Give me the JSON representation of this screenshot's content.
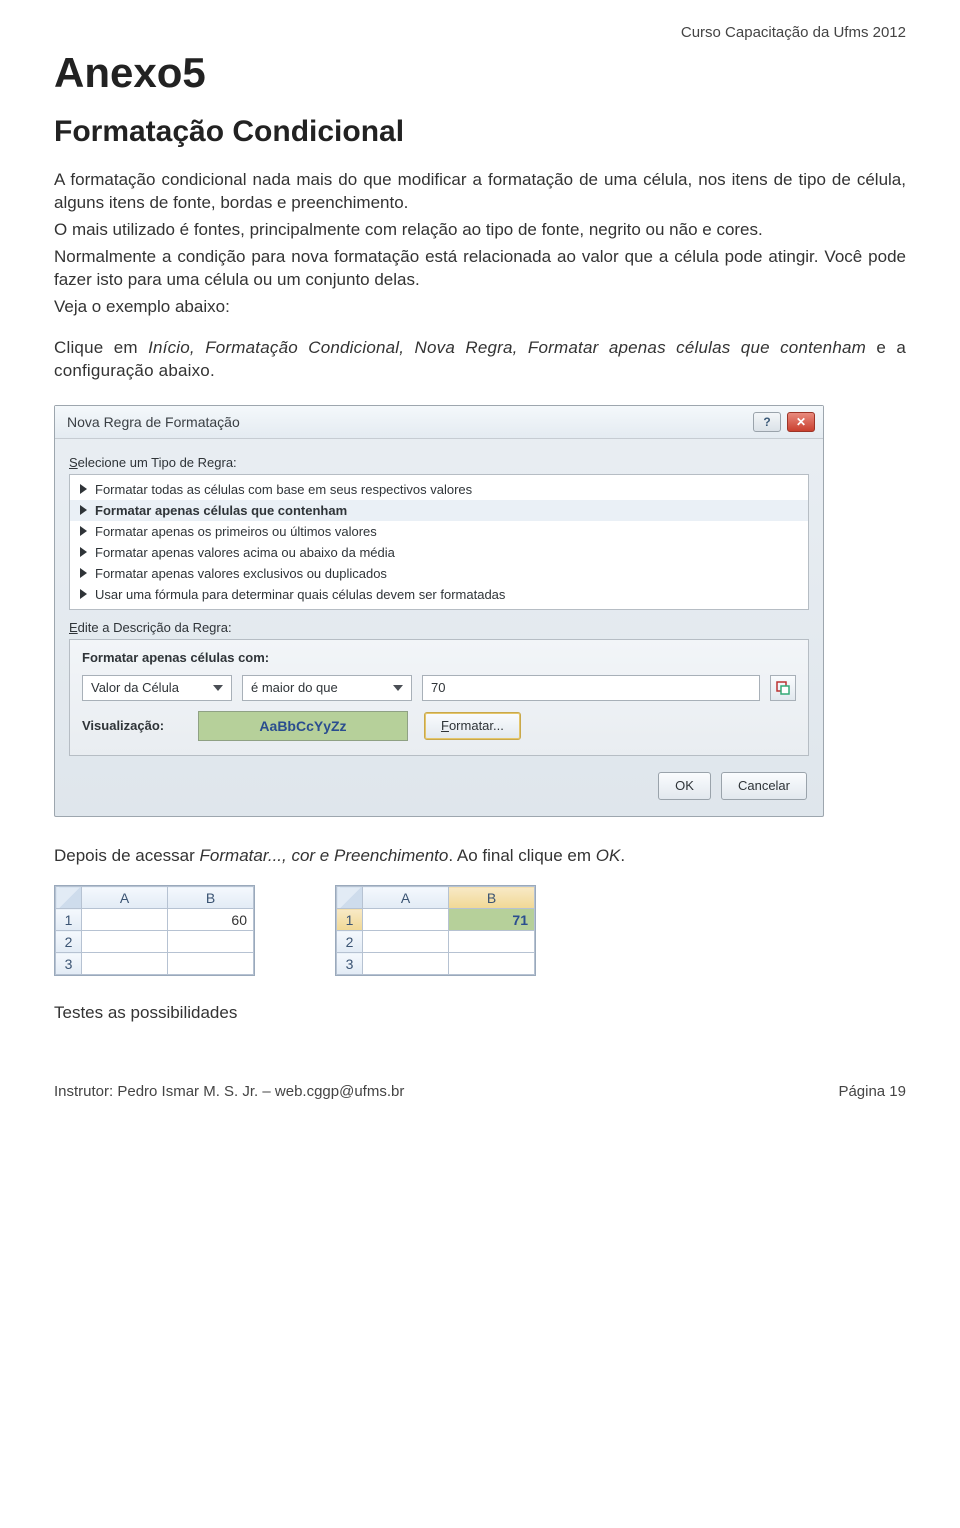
{
  "header": {
    "course": "Curso Capacitação da Ufms 2012"
  },
  "titles": {
    "h1": "Anexo5",
    "h2": "Formatação Condicional"
  },
  "paragraphs": {
    "p1": "A formatação condicional nada mais do que modificar a formatação de uma célula, nos itens de tipo de célula, alguns itens de fonte, bordas e preenchimento.",
    "p2": "O mais utilizado é fontes, principalmente com relação ao tipo de fonte, negrito ou não e cores.",
    "p3": "Normalmente a condição para nova formatação está relacionada ao valor que a célula pode atingir. Você pode fazer isto para uma célula ou um conjunto delas.",
    "p4": "Veja o exemplo abaixo:",
    "p5_prefix": "Clique em ",
    "p5_italic": "Início, Formatação Condicional, Nova Regra, Formatar apenas células que contenham",
    "p5_suffix": " e a configuração abaixo."
  },
  "dialog": {
    "title": "Nova Regra de Formatação",
    "help": "?",
    "close": "✕",
    "select_label_u": "S",
    "select_label_rest": "elecione um Tipo de Regra:",
    "rules": [
      "Formatar todas as células com base em seus respectivos valores",
      "Formatar apenas células que contenham",
      "Formatar apenas os primeiros ou últimos valores",
      "Formatar apenas valores acima ou abaixo da média",
      "Formatar apenas valores exclusivos ou duplicados",
      "Usar uma fórmula para determinar quais células devem ser formatadas"
    ],
    "edit_label_u": "E",
    "edit_label_rest": "dite a Descrição da Regra:",
    "sub_title": "Formatar apenas células com:",
    "combo1": "Valor da Célula",
    "combo2": "é maior do que",
    "value": "70",
    "preview_label": "Visualização:",
    "preview_text": "AaBbCcYyZz",
    "format_btn_u": "F",
    "format_btn_rest": "ormatar...",
    "ok": "OK",
    "cancel": "Cancelar"
  },
  "after": {
    "prefix": "Depois de acessar ",
    "italic1": "Formatar..., cor e Preenchimento",
    "mid": ". Ao final clique em ",
    "italic2": "OK",
    "suffix": "."
  },
  "sheets": {
    "left": {
      "cols": [
        "A",
        "B"
      ],
      "rows": [
        "1",
        "2",
        "3"
      ],
      "b1": "60"
    },
    "right": {
      "cols": [
        "A",
        "B"
      ],
      "rows": [
        "1",
        "2",
        "3"
      ],
      "b1": "71"
    }
  },
  "final": "Testes as possibilidades",
  "footer": {
    "left": "Instrutor: Pedro Ismar M. S. Jr. – web.cggp@ufms.br",
    "right": "Página 19"
  }
}
